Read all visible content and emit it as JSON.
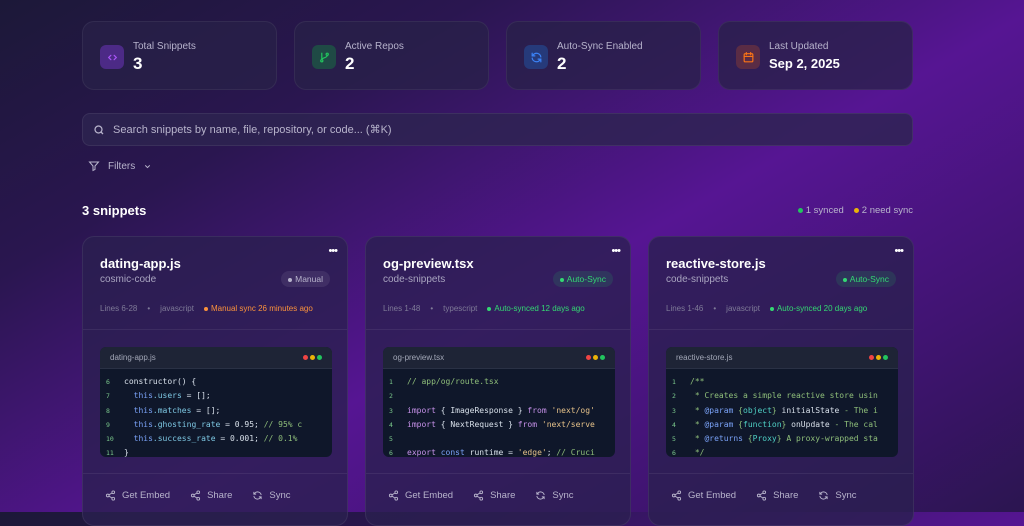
{
  "stats": [
    {
      "label": "Total Snippets",
      "value": "3",
      "icon": "code-icon",
      "color": "#a855f7",
      "bg": "#4c2a86"
    },
    {
      "label": "Active Repos",
      "value": "2",
      "icon": "git-branch-icon",
      "color": "#22c55e",
      "bg": "#1f4a45"
    },
    {
      "label": "Auto-Sync Enabled",
      "value": "2",
      "icon": "refresh-icon",
      "color": "#3b82f6",
      "bg": "#263a7a"
    },
    {
      "label": "Last Updated",
      "value": "Sep 2, 2025",
      "icon": "calendar-icon",
      "color": "#f97316",
      "bg": "#5a2c45"
    }
  ],
  "search": {
    "placeholder": "Search snippets by name, file, repository, or code... (⌘K)"
  },
  "filters": {
    "label": "Filters"
  },
  "summary": {
    "count": "3 snippets",
    "synced": "1 synced",
    "need_sync": "2 need sync",
    "synced_color": "#22c55e",
    "need_color": "#eab308"
  },
  "actions": {
    "embed": "Get Embed",
    "share": "Share",
    "sync": "Sync"
  },
  "snippets": [
    {
      "title": "dating-app.js",
      "repo": "cosmic-code",
      "badge": "Manual",
      "badge_type": "manual",
      "lines": "Lines 6-28",
      "lang": "javascript",
      "status": "Manual sync 26 minutes ago",
      "status_type": "manual",
      "file": "dating-app.js",
      "code": [
        [
          "6",
          [
            [
              "n",
              "constructor() {"
            ]
          ]
        ],
        [
          "7",
          [
            [
              "n",
              "  "
            ],
            [
              "b",
              "this"
            ],
            [
              "p",
              ".users"
            ],
            [
              "n",
              " = [];"
            ]
          ]
        ],
        [
          "8",
          [
            [
              "n",
              "  "
            ],
            [
              "b",
              "this"
            ],
            [
              "p",
              ".matches"
            ],
            [
              "n",
              " = [];"
            ]
          ]
        ],
        [
          "9",
          [
            [
              "n",
              "  "
            ],
            [
              "b",
              "this"
            ],
            [
              "p",
              ".ghosting_rate"
            ],
            [
              "n",
              " = 0.95; "
            ],
            [
              "c",
              "// 95% c"
            ]
          ]
        ],
        [
          "10",
          [
            [
              "n",
              "  "
            ],
            [
              "b",
              "this"
            ],
            [
              "p",
              ".success_rate"
            ],
            [
              "n",
              " = 0.001; "
            ],
            [
              "c",
              "// 0.1%"
            ]
          ]
        ],
        [
          "11",
          [
            [
              "n",
              "}"
            ]
          ]
        ]
      ]
    },
    {
      "title": "og-preview.tsx",
      "repo": "code-snippets",
      "badge": "Auto-Sync",
      "badge_type": "auto",
      "lines": "Lines 1-48",
      "lang": "typescript",
      "status": "Auto-synced 12 days ago",
      "status_type": "auto",
      "file": "og-preview.tsx",
      "code": [
        [
          "1",
          [
            [
              "c",
              "// app/og/route.tsx"
            ]
          ]
        ],
        [
          "2",
          []
        ],
        [
          "3",
          [
            [
              "k",
              "import"
            ],
            [
              "n",
              " { ImageResponse } "
            ],
            [
              "k",
              "from"
            ],
            [
              "s",
              " 'next/og'"
            ]
          ]
        ],
        [
          "4",
          [
            [
              "k",
              "import"
            ],
            [
              "n",
              " { NextRequest } "
            ],
            [
              "k",
              "from"
            ],
            [
              "s",
              " 'next/serve"
            ]
          ]
        ],
        [
          "5",
          []
        ],
        [
          "6",
          [
            [
              "k",
              "export"
            ],
            [
              "b",
              " const"
            ],
            [
              "n",
              " runtime = "
            ],
            [
              "s",
              "'edge'"
            ],
            [
              "n",
              "; "
            ],
            [
              "c",
              "// Cruci"
            ]
          ]
        ]
      ]
    },
    {
      "title": "reactive-store.js",
      "repo": "code-snippets",
      "badge": "Auto-Sync",
      "badge_type": "auto",
      "lines": "Lines 1-46",
      "lang": "javascript",
      "status": "Auto-synced 20 days ago",
      "status_type": "auto",
      "file": "reactive-store.js",
      "code": [
        [
          "1",
          [
            [
              "c",
              "/**"
            ]
          ]
        ],
        [
          "2",
          [
            [
              "c",
              " * Creates a simple reactive store usin"
            ]
          ]
        ],
        [
          "3",
          [
            [
              "c",
              " * "
            ],
            [
              "b",
              "@param"
            ],
            [
              "c",
              " {"
            ],
            [
              "t",
              "object"
            ],
            [
              "c",
              "} "
            ],
            [
              "n",
              "initialState"
            ],
            [
              "c",
              " - The i"
            ]
          ]
        ],
        [
          "4",
          [
            [
              "c",
              " * "
            ],
            [
              "b",
              "@param"
            ],
            [
              "c",
              " {"
            ],
            [
              "t",
              "function"
            ],
            [
              "c",
              "} "
            ],
            [
              "n",
              "onUpdate"
            ],
            [
              "c",
              " - The cal"
            ]
          ]
        ],
        [
          "5",
          [
            [
              "c",
              " * "
            ],
            [
              "b",
              "@returns"
            ],
            [
              "c",
              " {"
            ],
            [
              "t",
              "Proxy"
            ],
            [
              "c",
              "} A proxy-wrapped sta"
            ]
          ]
        ],
        [
          "6",
          [
            [
              "c",
              " */"
            ]
          ]
        ]
      ]
    }
  ]
}
